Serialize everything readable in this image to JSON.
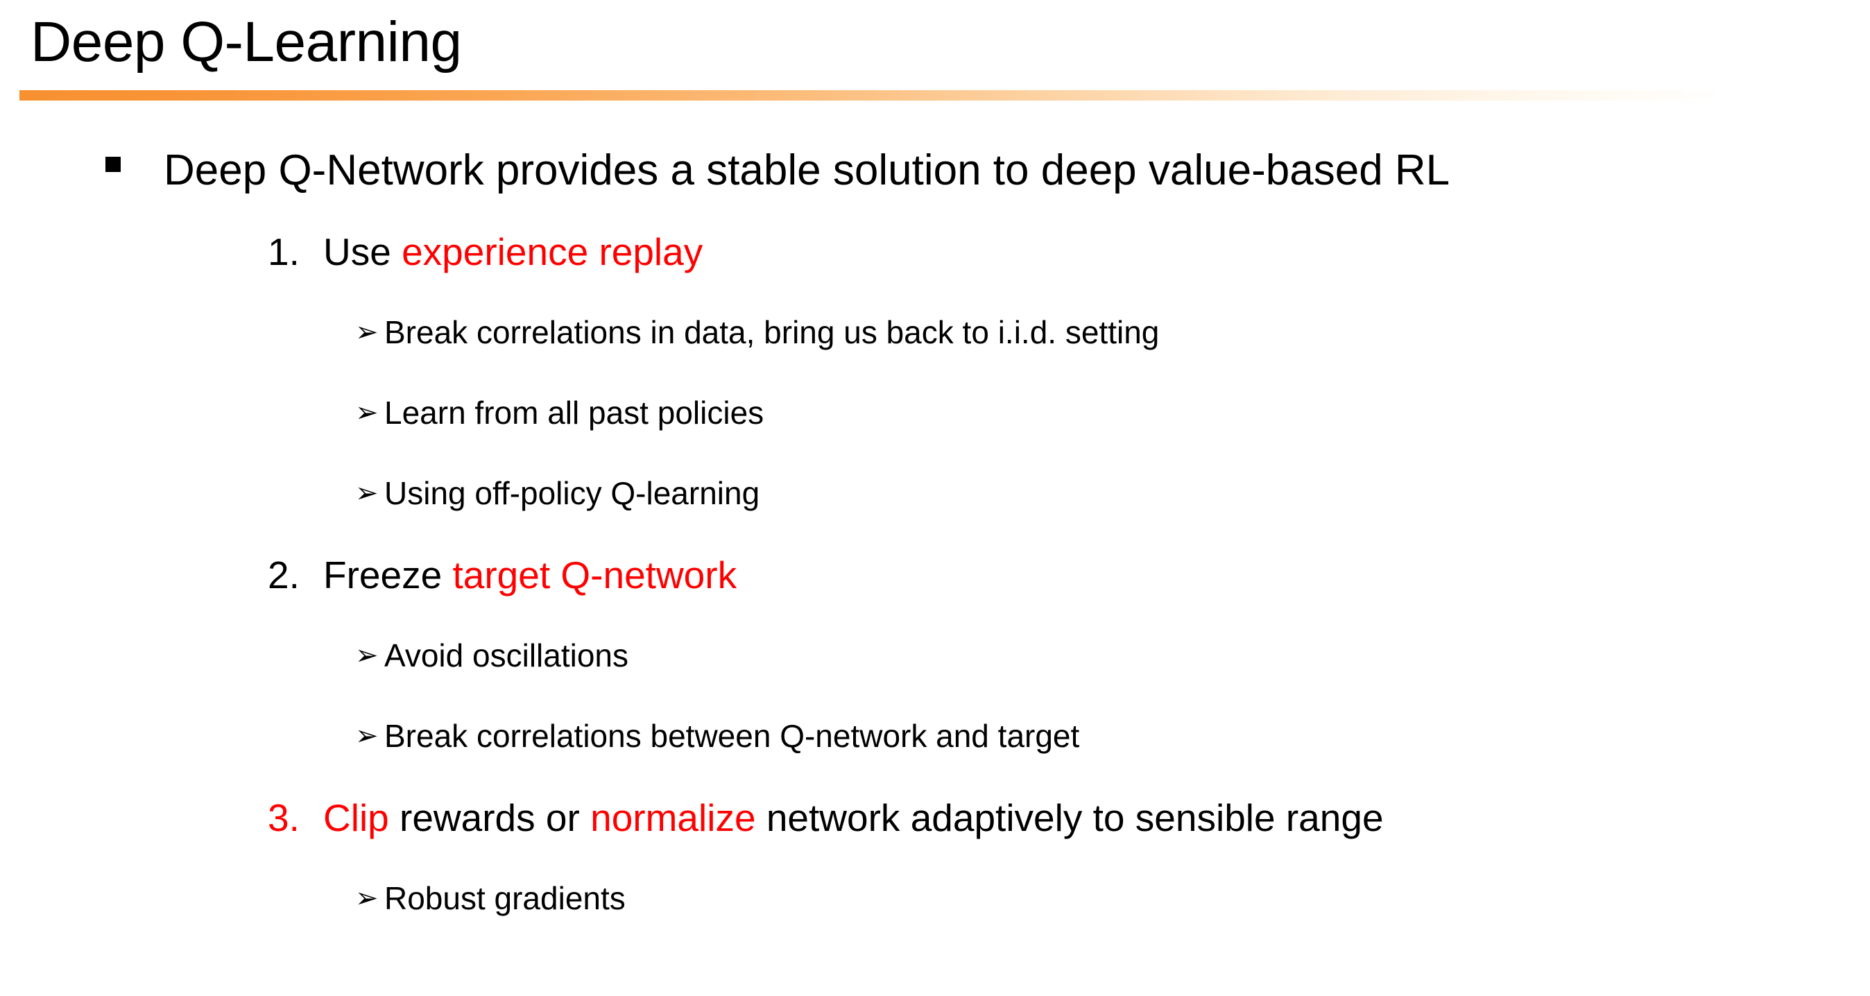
{
  "slide": {
    "title": "Deep Q-Learning",
    "accent_color": "#F7902F",
    "highlight_color": "#FF0000",
    "text_color": "#000000",
    "background_color": "#FFFFFF"
  },
  "bullets": {
    "square_marker": "▪",
    "arrow_marker": "➢",
    "main": {
      "text": "Deep Q-Network provides a stable solution to deep value-based RL"
    },
    "items": [
      {
        "number": "1.",
        "number_highlighted": false,
        "parts": [
          {
            "text": "Use ",
            "highlight": false
          },
          {
            "text": "experience replay",
            "highlight": true
          }
        ],
        "subs": [
          "Break correlations in data, bring us back to i.i.d. setting",
          "Learn from all past policies",
          "Using off-policy Q-learning"
        ]
      },
      {
        "number": "2.",
        "number_highlighted": false,
        "parts": [
          {
            "text": "Freeze ",
            "highlight": false
          },
          {
            "text": "target Q-network",
            "highlight": true
          }
        ],
        "subs": [
          "Avoid oscillations",
          "Break correlations between Q-network and target"
        ]
      },
      {
        "number": "3.",
        "number_highlighted": true,
        "parts": [
          {
            "text": "Clip",
            "highlight": true
          },
          {
            "text": " rewards or ",
            "highlight": false
          },
          {
            "text": "normalize",
            "highlight": true
          },
          {
            "text": " network adaptively to sensible range",
            "highlight": false
          }
        ],
        "subs": [
          "Robust gradients"
        ]
      }
    ]
  }
}
